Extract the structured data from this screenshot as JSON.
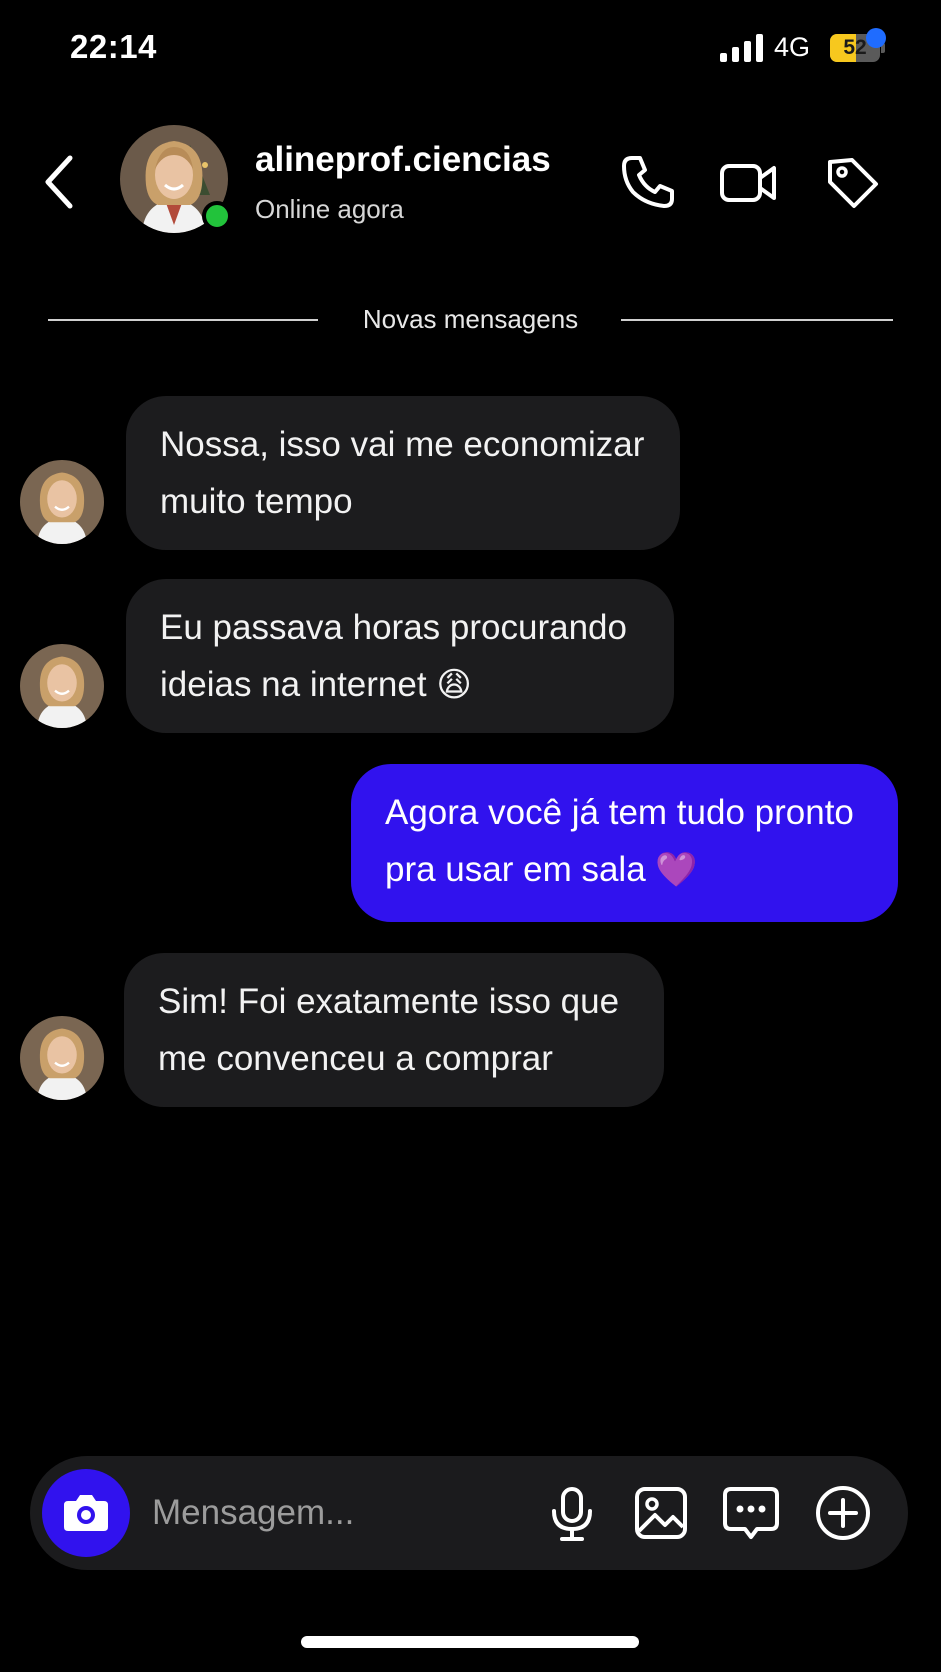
{
  "status_bar": {
    "time": "22:14",
    "network": "4G",
    "battery_percent": 52,
    "battery_label": "52"
  },
  "header": {
    "username": "alineprof.ciencias",
    "presence": "Online agora",
    "online": true,
    "icons": [
      "chevron-left-icon",
      "phone-icon",
      "video-icon",
      "tag-icon"
    ],
    "tag_notification": true
  },
  "divider": {
    "label": "Novas mensagens"
  },
  "messages": [
    {
      "direction": "incoming",
      "lines": [
        "Nossa, isso vai me economizar",
        "muito tempo"
      ]
    },
    {
      "direction": "incoming",
      "lines": [
        "Eu passava horas procurando",
        "ideias na internet"
      ],
      "emoji": "😩"
    },
    {
      "direction": "outgoing",
      "lines": [
        "Agora você já tem tudo pronto",
        "pra usar em sala"
      ],
      "emoji": "💜"
    },
    {
      "direction": "incoming",
      "lines": [
        "Sim! Foi exatamente isso que",
        "me convenceu a comprar"
      ]
    }
  ],
  "composer": {
    "placeholder": "Mensagem...",
    "value": "",
    "icons": [
      "camera-icon",
      "microphone-icon",
      "gallery-icon",
      "sticker-icon",
      "plus-icon"
    ]
  },
  "colors": {
    "background": "#000000",
    "incoming_bubble": "#1c1c1e",
    "outgoing_bubble": "#3112ee",
    "online": "#22c33b",
    "notification": "#1f6cff",
    "battery": "#f7c81e"
  }
}
